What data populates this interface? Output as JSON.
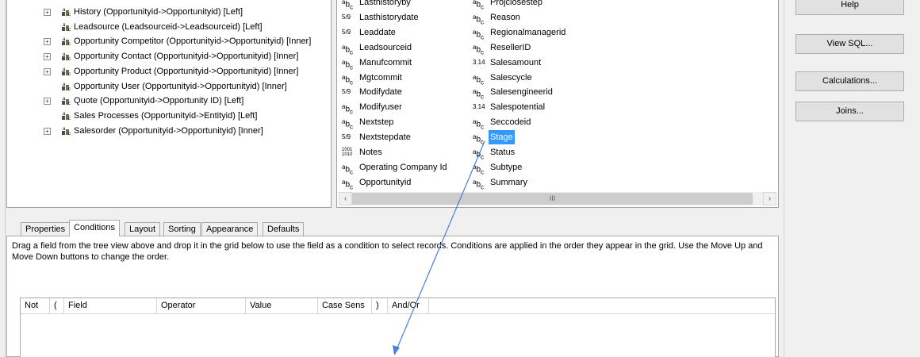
{
  "tree": {
    "items": [
      {
        "label": "History (Opportunityid->Opportunityid) [Left]",
        "expandable": true
      },
      {
        "label": "Leadsource (Leadsourceid->Leadsourceid) [Left]",
        "expandable": false
      },
      {
        "label": "Opportunity Competitor (Opportunityid->Opportunityid) [Inner]",
        "expandable": true
      },
      {
        "label": "Opportunity Contact (Opportunityid->Opportunityid) [Inner]",
        "expandable": true
      },
      {
        "label": "Opportunity Product (Opportunityid->Opportunityid) [Inner]",
        "expandable": true
      },
      {
        "label": "Opportunity User (Opportunityid->Opportunityid) [Inner]",
        "expandable": false
      },
      {
        "label": "Quote (Opportunityid->Opportunity ID) [Left]",
        "expandable": true
      },
      {
        "label": "Sales Processes (Opportunityid->Entityid) [Left]",
        "expandable": false
      },
      {
        "label": "Salesorder (Opportunityid->Opportunityid) [Inner]",
        "expandable": true
      }
    ]
  },
  "fields": {
    "col1": [
      {
        "type": "text",
        "type_glyph": "ab",
        "label": "Lasthistoryby"
      },
      {
        "type": "date",
        "type_glyph": "5/9",
        "label": "Lasthistorydate"
      },
      {
        "type": "date",
        "type_glyph": "5/9",
        "label": "Leaddate"
      },
      {
        "type": "text",
        "type_glyph": "ab",
        "label": "Leadsourceid"
      },
      {
        "type": "text",
        "type_glyph": "ab",
        "label": "Manufcommit"
      },
      {
        "type": "text",
        "type_glyph": "ab",
        "label": "Mgtcommit"
      },
      {
        "type": "date",
        "type_glyph": "5/9",
        "label": "Modifydate"
      },
      {
        "type": "text",
        "type_glyph": "ab",
        "label": "Modifyuser"
      },
      {
        "type": "text",
        "type_glyph": "ab",
        "label": "Nextstep"
      },
      {
        "type": "date",
        "type_glyph": "5/9",
        "label": "Nextstepdate"
      },
      {
        "type": "memo",
        "type_glyph": "1001 1010",
        "label": "Notes"
      },
      {
        "type": "text",
        "type_glyph": "ab",
        "label": "Operating Company Id"
      },
      {
        "type": "text",
        "type_glyph": "ab",
        "label": "Opportunityid"
      }
    ],
    "col2": [
      {
        "type": "text",
        "type_glyph": "ab",
        "label": "Projclosestep"
      },
      {
        "type": "text",
        "type_glyph": "ab",
        "label": "Reason"
      },
      {
        "type": "text",
        "type_glyph": "ab",
        "label": "Regionalmanagerid"
      },
      {
        "type": "text",
        "type_glyph": "ab",
        "label": "ResellerID"
      },
      {
        "type": "number",
        "type_glyph": "3.14",
        "label": "Salesamount"
      },
      {
        "type": "text",
        "type_glyph": "ab",
        "label": "Salescycle"
      },
      {
        "type": "text",
        "type_glyph": "ab",
        "label": "Salesengineerid"
      },
      {
        "type": "number",
        "type_glyph": "3.14",
        "label": "Salespotential"
      },
      {
        "type": "text",
        "type_glyph": "ab",
        "label": "Seccodeid"
      },
      {
        "type": "text",
        "type_glyph": "ab",
        "label": "Stage",
        "selected": true
      },
      {
        "type": "text",
        "type_glyph": "ab",
        "label": "Status"
      },
      {
        "type": "text",
        "type_glyph": "ab",
        "label": "Subtype"
      },
      {
        "type": "text",
        "type_glyph": "ab",
        "label": "Summary"
      }
    ],
    "scroll_grip": "III"
  },
  "buttons": {
    "help": "Help",
    "view_sql": "View SQL...",
    "calculations": "Calculations...",
    "joins": "Joins..."
  },
  "tabs": [
    {
      "label": "Properties",
      "active": false
    },
    {
      "label": "Conditions",
      "active": true
    },
    {
      "label": "Layout",
      "active": false
    },
    {
      "label": "Sorting",
      "active": false
    },
    {
      "label": "Appearance",
      "active": false
    },
    {
      "label": "Defaults",
      "active": false
    }
  ],
  "conditions": {
    "instructions": "Drag a field from the tree view above and drop it in the grid below to use the field as a condition to select records.  Conditions are applied in the order they appear in the grid.  Use the Move Up and Move Down buttons to change the order.",
    "columns": [
      "Not",
      "(",
      "Field",
      "Operator",
      "Value",
      "Case Sens",
      ")",
      "And/Or"
    ]
  },
  "colors": {
    "selection": "#3399ff",
    "annotation_arrow": "#4a7fd6"
  }
}
